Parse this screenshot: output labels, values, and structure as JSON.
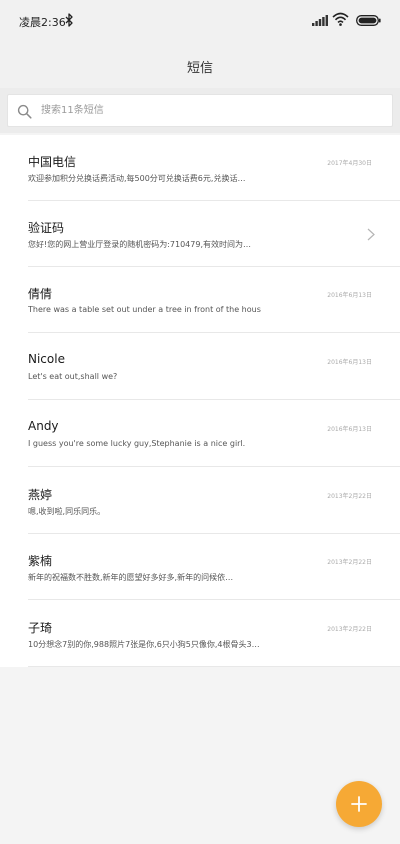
{
  "status_bar": {
    "time": "凌晨2:36"
  },
  "header": {
    "title": "短信"
  },
  "search": {
    "placeholder": "搜索11条短信"
  },
  "conversations": [
    {
      "name": "中国电信",
      "date": "2017年4月30日",
      "preview": "欢迎参加积分兑换话费活动,每500分可兑换话费6元,兑换话…"
    },
    {
      "name": "验证码",
      "date": "",
      "preview": "您好!您的网上营业厅登录的随机密码为:710479,有效时间为…"
    },
    {
      "name": "倩倩",
      "date": "2016年6月13日",
      "preview": "There was a table set out under a tree in front of the hous"
    },
    {
      "name": "Nicole",
      "date": "2016年6月13日",
      "preview": "Let's eat out,shall we?"
    },
    {
      "name": "Andy",
      "date": "2016年6月13日",
      "preview": "I guess you're some lucky guy,Stephanie is a nice girl."
    },
    {
      "name": "燕婷",
      "date": "2013年2月22日",
      "preview": "嗯,收到啦,同乐同乐。"
    },
    {
      "name": "紫楠",
      "date": "2013年2月22日",
      "preview": "新年的祝福数不胜数,新年的愿望好多好多,新年的问候依…"
    },
    {
      "name": "子琦",
      "date": "2013年2月22日",
      "preview": "10分想念7别的你,988照片7张是你,6只小狗5只像你,4根骨头3…"
    }
  ],
  "colors": {
    "accent": "#f6a935",
    "background": "#f4f4f4",
    "list_background": "#ffffff",
    "divider": "#e8e8e8"
  },
  "icons": {
    "bluetooth": "bluetooth-icon",
    "signal": "signal-icon",
    "wifi": "wifi-icon",
    "battery": "battery-icon",
    "search": "search-icon",
    "chevron": "chevron-right-icon",
    "compose": "plus-icon"
  }
}
